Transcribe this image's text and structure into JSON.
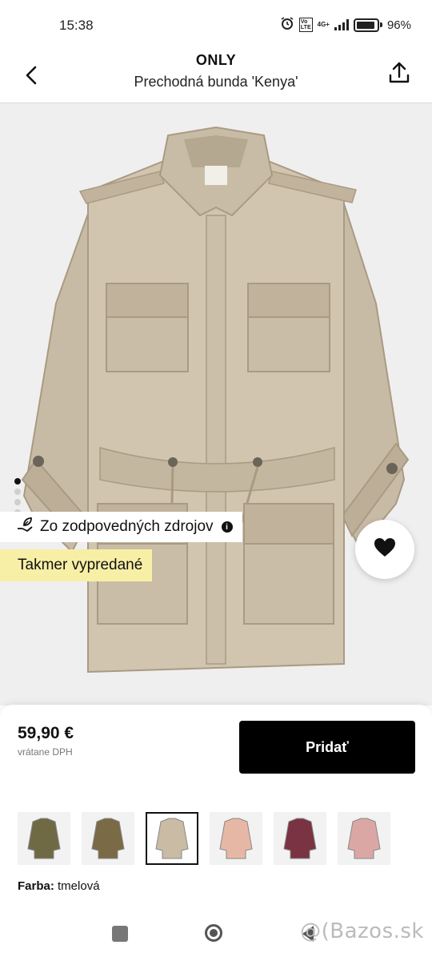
{
  "status_bar": {
    "time": "15:38",
    "network": "4G+",
    "battery": "96%"
  },
  "header": {
    "brand": "ONLY",
    "product_name": "Prechodná bunda 'Kenya'"
  },
  "gallery": {
    "image_count": 6,
    "active_index": 0
  },
  "labels": {
    "sustainability": "Zo zodpovedných zdrojov",
    "stock": "Takmer vypredané"
  },
  "purchase": {
    "price": "59,90 €",
    "vat_note": "vrátane DPH",
    "add_button": "Pridať"
  },
  "color": {
    "label": "Farba:",
    "value": "tmelová"
  },
  "swatch_colors": [
    "#6f6a44",
    "#7a6a45",
    "#c9bba4",
    "#e7b7a5",
    "#7a3342",
    "#dba7a4"
  ],
  "selected_swatch": 2,
  "watermark": "@(Bazos.sk"
}
